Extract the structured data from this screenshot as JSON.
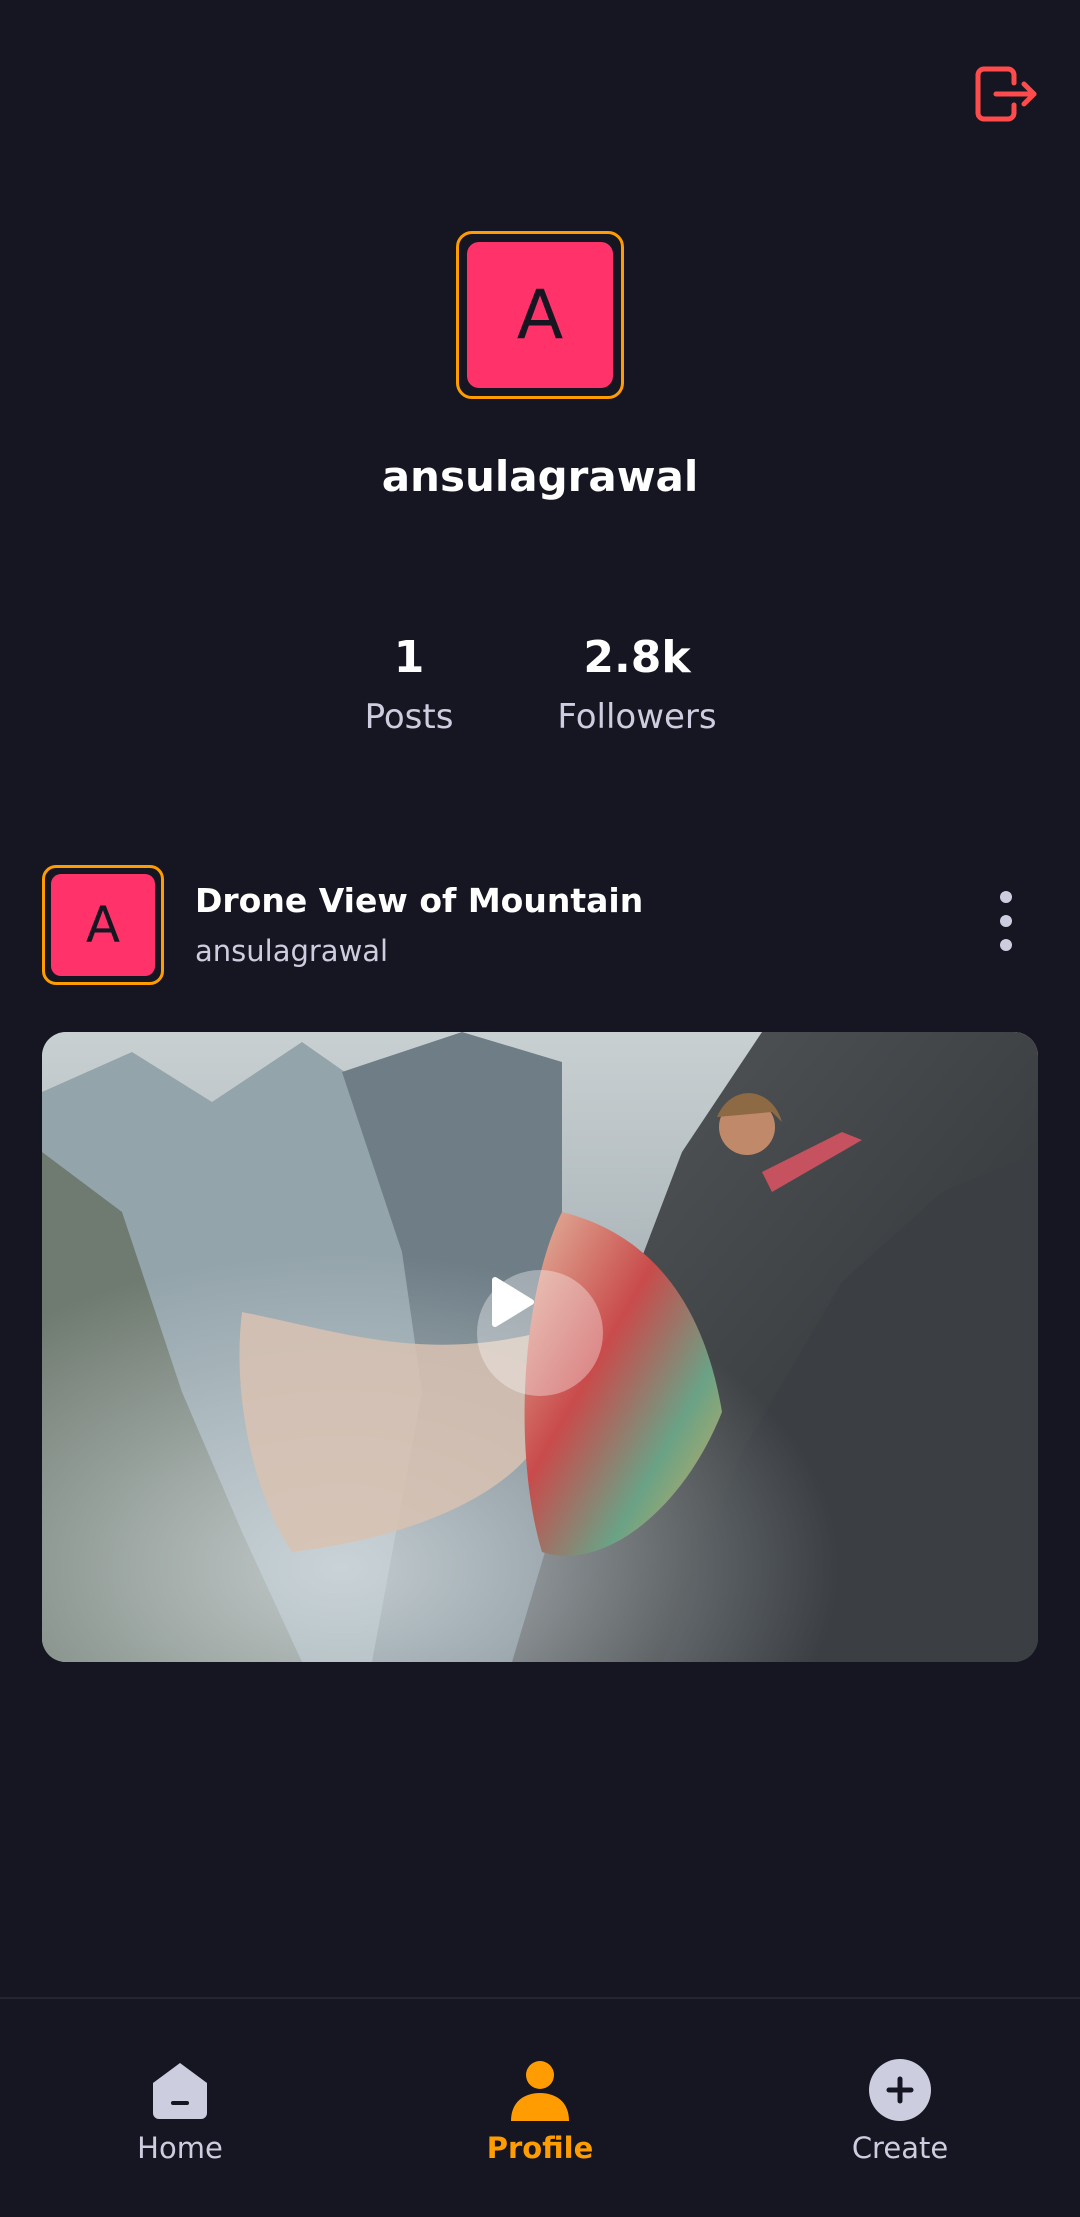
{
  "profile": {
    "avatar_letter": "A",
    "username": "ansulagrawal",
    "stats": {
      "posts_value": "1",
      "posts_label": "Posts",
      "followers_value": "2.8k",
      "followers_label": "Followers"
    }
  },
  "post": {
    "avatar_letter": "A",
    "title": "Drone View of Mountain",
    "author": "ansulagrawal"
  },
  "tabs": [
    {
      "label": "Home",
      "icon": "home-icon",
      "active": false
    },
    {
      "label": "Profile",
      "icon": "profile-icon",
      "active": true
    },
    {
      "label": "Create",
      "icon": "plus-icon",
      "active": false
    }
  ],
  "colors": {
    "background": "#161622",
    "accent": "#FF9C01",
    "avatar_bg": "#FF3369",
    "logout": "#FF4B4B",
    "secondary_text": "#CDCDE0"
  }
}
